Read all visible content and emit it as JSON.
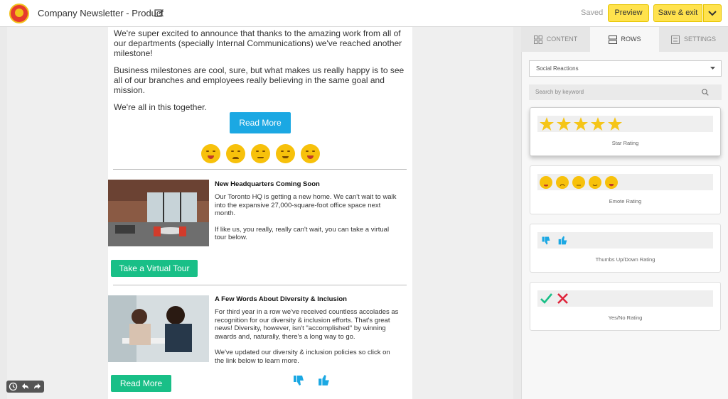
{
  "header": {
    "title": "Company Newsletter - Product",
    "saved_status": "Saved",
    "preview_label": "Preview",
    "save_exit_label": "Save & exit"
  },
  "email": {
    "intro_paragraphs": [
      "We're super excited to announce that thanks to the amazing work from all of our departments (specially Internal Communications) we've reached another milestone!",
      "Business milestones are cool, sure, but what makes us really happy is to see all of our branches and employees really believing in the same goal and mission.",
      "We're all in this together."
    ],
    "read_more_label": "Read More",
    "emote_count": 5,
    "article1": {
      "title": "New Headquarters Coming Soon",
      "paragraphs": [
        "Our Toronto HQ is getting a new home. We can't wait to walk into the expansive 27,000-square-foot office space next month.",
        "If like us, you really, really can't wait, you can take a virtual tour below."
      ],
      "button_label": "Take a Virtual Tour"
    },
    "article2": {
      "title": "A Few Words About Diversity & Inclusion",
      "paragraphs": [
        "For third year in a row we've received countless accolades as recognition for our diversity & inclusion efforts. That's great news! Diversity, however, isn't \"accomplished\" by winning awards and, naturally, there's a long way to go.",
        "We've updated our diversity & inclusion policies so click on the link below to learn more."
      ],
      "button_label": "Read More"
    }
  },
  "panel": {
    "tabs": [
      {
        "label": "CONTENT",
        "icon": "grid-icon"
      },
      {
        "label": "ROWS",
        "icon": "rows-icon"
      },
      {
        "label": "SETTINGS",
        "icon": "settings-icon"
      }
    ],
    "active_tab": "ROWS",
    "category_select": "Social Reactions",
    "search_placeholder": "Search by keyword",
    "cards": [
      {
        "label": "Star Rating"
      },
      {
        "label": "Emote Rating"
      },
      {
        "label": "Thumbs Up/Down Rating"
      },
      {
        "label": "Yes/No Rating"
      }
    ]
  },
  "colors": {
    "accent_yellow": "#ffe24d",
    "read_more_blue": "#1ba8e3",
    "cta_green": "#19bf87",
    "star": "#f5c518",
    "thumbs_blue": "#1ba8e3",
    "yes_green": "#19bf87",
    "no_red": "#e0233a"
  }
}
